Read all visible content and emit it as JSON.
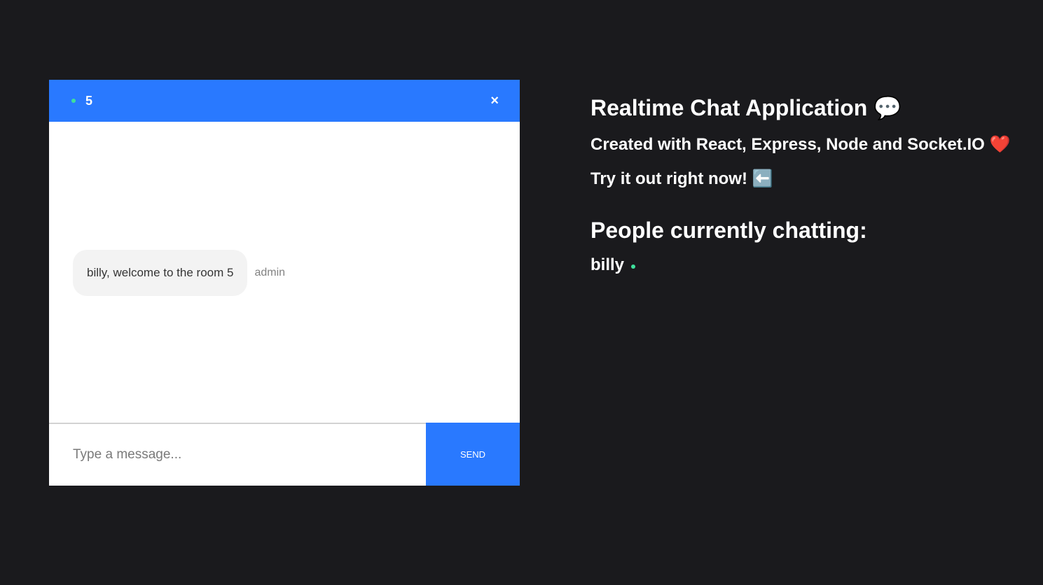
{
  "chat": {
    "room": "5",
    "close_symbol": "×",
    "messages": [
      {
        "text": "billy, welcome to the room 5",
        "sender": "admin"
      }
    ],
    "input_placeholder": "Type a message...",
    "send_label": "SEND"
  },
  "info": {
    "title": "Realtime Chat Application",
    "title_emoji": "💬",
    "subtitle": "Created with React, Express, Node and Socket.IO",
    "subtitle_emoji": "❤️",
    "cta": "Try it out right now!",
    "cta_emoji": "⬅️",
    "people_heading": "People currently chatting:",
    "users": [
      "billy"
    ]
  },
  "colors": {
    "background": "#1a1a1d",
    "accent": "#2979ff",
    "online": "#3ee09c",
    "bubble": "#f3f3f3"
  },
  "icons": {
    "online": "online-dot-icon",
    "close": "close-icon",
    "speech": "speech-bubble-icon",
    "heart": "heart-icon",
    "arrow": "left-arrow-icon"
  }
}
